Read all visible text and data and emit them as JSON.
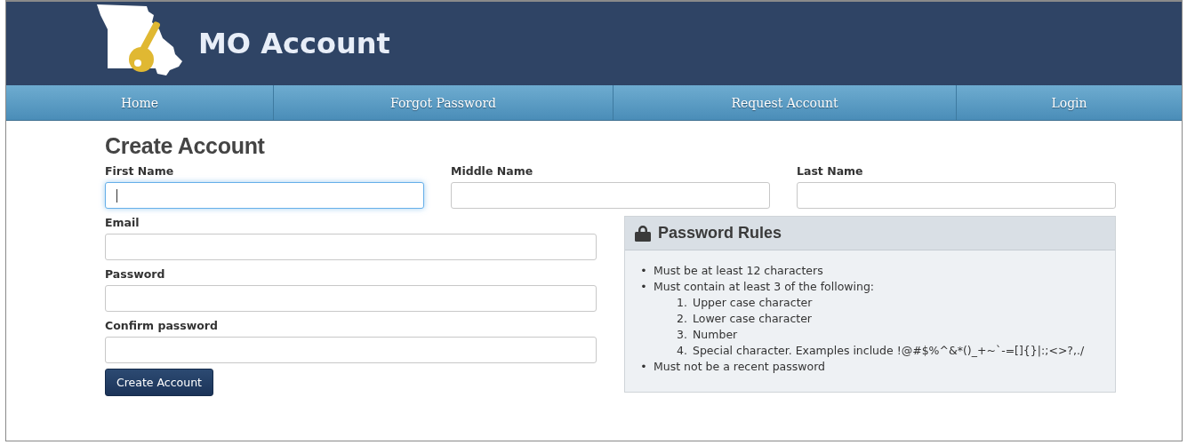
{
  "header": {
    "title": "MO Account"
  },
  "nav": [
    {
      "label": "Home"
    },
    {
      "label": "Forgot Password"
    },
    {
      "label": "Request Account"
    },
    {
      "label": "Login"
    }
  ],
  "form": {
    "heading": "Create Account",
    "name_fields": [
      {
        "label": "First Name",
        "focused": true
      },
      {
        "label": "Middle Name",
        "focused": false
      },
      {
        "label": "Last Name",
        "focused": false
      }
    ],
    "fields": [
      {
        "label": "Email",
        "focused": false
      },
      {
        "label": "Password",
        "focused": false
      },
      {
        "label": "Confirm password",
        "focused": false
      }
    ],
    "submit": "Create Account"
  },
  "password_rules": {
    "title": "Password Rules",
    "rules": [
      {
        "marker": "•",
        "text": "Must be at least 12 characters"
      },
      {
        "marker": "•",
        "text": "Must contain at least 3 of the following:",
        "children": [
          {
            "marker": "1.",
            "text": "Upper case character"
          },
          {
            "marker": "2.",
            "text": "Lower case character"
          },
          {
            "marker": "3.",
            "text": "Number"
          },
          {
            "marker": "4.",
            "text": "Special character. Examples include !@#$%^&*()_+~`-=[]{}|:;<>?,./"
          }
        ]
      },
      {
        "marker": "•",
        "text": "Must not be a recent password"
      }
    ]
  }
}
